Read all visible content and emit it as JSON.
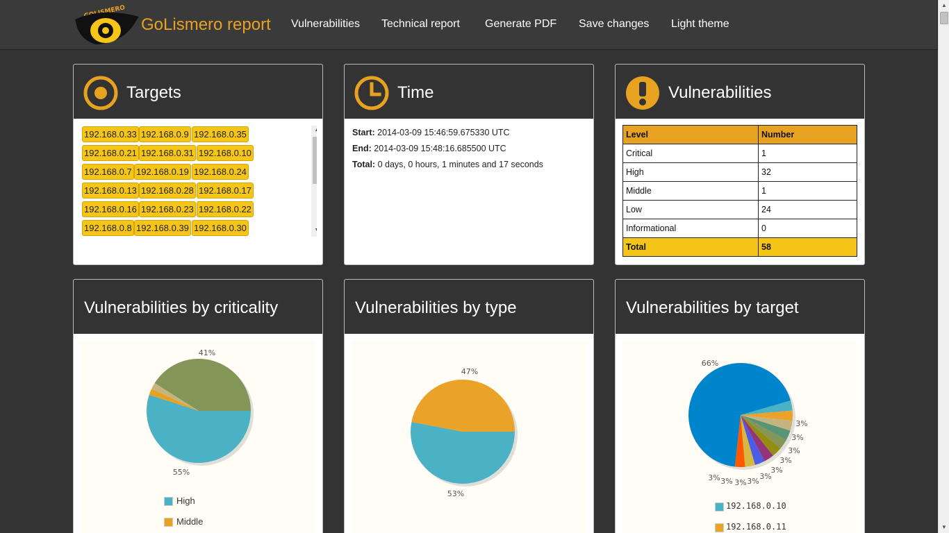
{
  "app": {
    "title": "GoLismero report",
    "logo_text": "GOLISMERO",
    "accent": "#e8a221"
  },
  "nav": {
    "items": [
      {
        "label": "Vulnerabilities"
      },
      {
        "label": "Technical report"
      },
      {
        "label": "Generate PDF"
      },
      {
        "label": "Save changes"
      },
      {
        "label": "Light theme"
      }
    ]
  },
  "targets": {
    "title": "Targets",
    "icon": "target-icon",
    "items": [
      "192.168.0.33",
      "192.168.0.9",
      "192.168.0.35",
      "192.168.0.21",
      "192.168.0.31",
      "192.168.0.10",
      "192.168.0.7",
      "192.168.0.19",
      "192.168.0.24",
      "192.168.0.13",
      "192.168.0.28",
      "192.168.0.17",
      "192.168.0.16",
      "192.168.0.23",
      "192.168.0.22",
      "192.168.0.8",
      "192.168.0.39",
      "192.168.0.30"
    ]
  },
  "time": {
    "title": "Time",
    "icon": "clock-icon",
    "start_label": "Start:",
    "start_value": "2014-03-09 15:46:59.675330 UTC",
    "end_label": "End:",
    "end_value": "2014-03-09 15:48:16.685500 UTC",
    "total_label": "Total:",
    "total_value": "0 days, 0 hours, 1 minutes and 17 seconds"
  },
  "vulnerabilities": {
    "title": "Vulnerabilities",
    "icon": "exclamation-icon",
    "headers": [
      "Level",
      "Number"
    ],
    "rows": [
      {
        "level": "Critical",
        "number": "1"
      },
      {
        "level": "High",
        "number": "32"
      },
      {
        "level": "Middle",
        "number": "1"
      },
      {
        "level": "Low",
        "number": "24"
      },
      {
        "level": "Informational",
        "number": "0"
      }
    ],
    "total": {
      "level": "Total",
      "number": "58"
    }
  },
  "chart_data": [
    {
      "type": "pie",
      "title": "Vulnerabilities by criticality",
      "series": [
        {
          "name": "High",
          "value": 55,
          "color": "#4bb2c5"
        },
        {
          "name": "Middle",
          "value": 2,
          "color": "#e8a221"
        },
        {
          "name": "",
          "value": 2,
          "color": "#c5b47f"
        },
        {
          "name": "",
          "value": 41,
          "color": "#839557"
        }
      ],
      "labels": [
        {
          "text": "41%"
        },
        {
          "text": "55%"
        }
      ]
    },
    {
      "type": "pie",
      "title": "Vulnerabilities by type",
      "series": [
        {
          "name": "",
          "value": 53,
          "color": "#4bb2c5"
        },
        {
          "name": "",
          "value": 47,
          "color": "#eaa228"
        }
      ],
      "labels": [
        {
          "text": "47%"
        },
        {
          "text": "53%"
        }
      ]
    },
    {
      "type": "pie",
      "title": "Vulnerabilities by target",
      "series": [
        {
          "name": "192.168.0.10",
          "value": 3,
          "color": "#4bb2c5"
        },
        {
          "name": "192.168.0.11",
          "value": 3,
          "color": "#eaa228"
        },
        {
          "name": "",
          "value": 3,
          "color": "#c5b47f"
        },
        {
          "name": "",
          "value": 3,
          "color": "#579575"
        },
        {
          "name": "",
          "value": 3,
          "color": "#839557"
        },
        {
          "name": "",
          "value": 3,
          "color": "#958c12"
        },
        {
          "name": "",
          "value": 3,
          "color": "#953579"
        },
        {
          "name": "",
          "value": 3,
          "color": "#4b5de4"
        },
        {
          "name": "",
          "value": 3,
          "color": "#d8b83f"
        },
        {
          "name": "",
          "value": 3,
          "color": "#ff5800"
        },
        {
          "name": "",
          "value": 66,
          "color": "#0085cc"
        }
      ],
      "labels": [
        {
          "text": "66%"
        },
        {
          "text": "3%"
        },
        {
          "text": "3%"
        },
        {
          "text": "3%"
        },
        {
          "text": "3%"
        },
        {
          "text": "3%"
        },
        {
          "text": "3%"
        },
        {
          "text": "3%"
        },
        {
          "text": "3%"
        },
        {
          "text": "3%"
        },
        {
          "text": "3%"
        }
      ]
    }
  ]
}
